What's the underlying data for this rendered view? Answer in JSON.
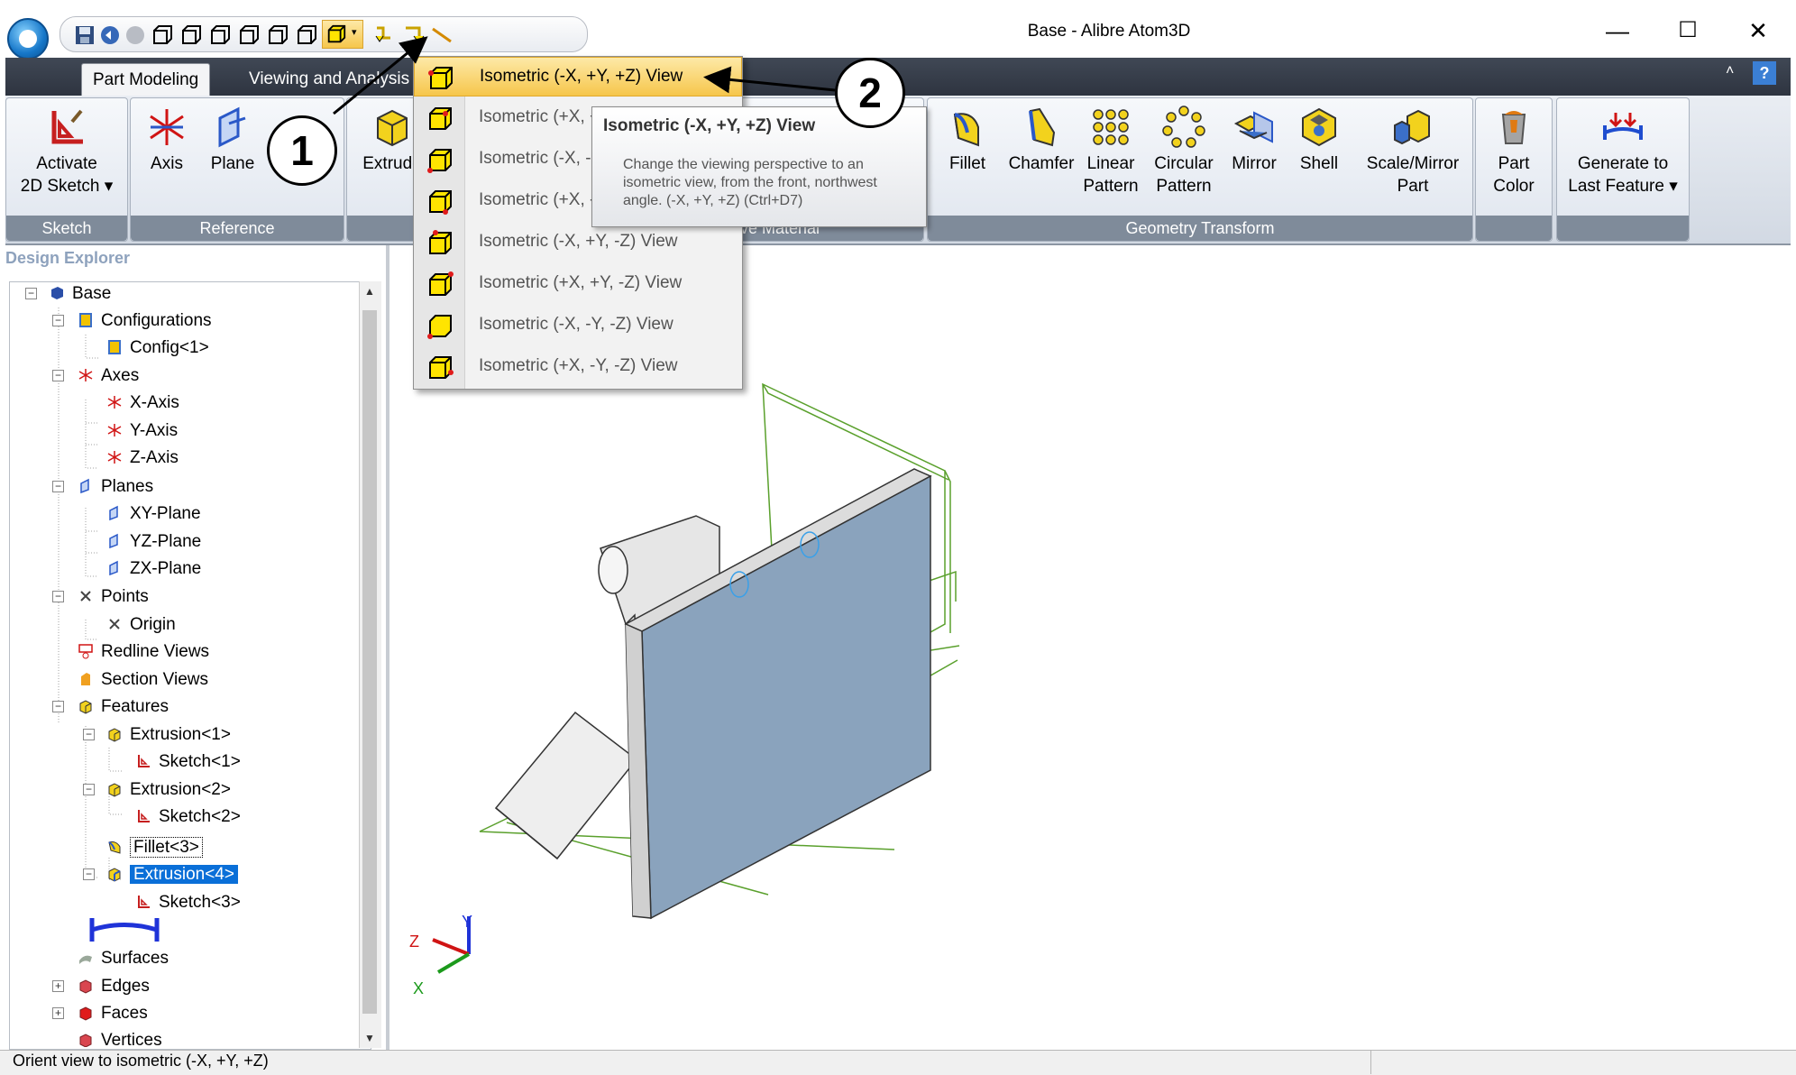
{
  "window": {
    "title": "Base - Alibre Atom3D",
    "minimize_glyph": "—",
    "maximize_glyph": "☐",
    "close_glyph": "✕"
  },
  "ribbon_tabs": [
    "Part Modeling",
    "Viewing and Analysis"
  ],
  "help_glyph": "?",
  "collapse_glyph": "˄",
  "ribbon_groups": {
    "sketch": {
      "label": "Sketch",
      "buttons": [
        {
          "label_line1": "Activate",
          "label_line2": "2D Sketch ▾"
        }
      ]
    },
    "reference": {
      "label": "Reference",
      "buttons": [
        {
          "label_line1": "Axis"
        },
        {
          "label_line1": "Plane"
        }
      ]
    },
    "add_material": {
      "buttons": [
        {
          "label_line1": "Extrude"
        }
      ]
    },
    "remove_material": {
      "label": "Remove Material"
    },
    "geometry_transform": {
      "label": "Geometry Transform",
      "buttons": [
        {
          "label_line1": "Fillet"
        },
        {
          "label_line1": "Chamfer"
        },
        {
          "label_line1": "Linear",
          "label_line2": "Pattern"
        },
        {
          "label_line1": "Circular",
          "label_line2": "Pattern"
        },
        {
          "label_line1": "Mirror"
        },
        {
          "label_line1": "Shell"
        },
        {
          "label_line1": "Scale/Mirror",
          "label_line2": "Part"
        }
      ]
    },
    "part_color": {
      "buttons": [
        {
          "label_line1": "Part",
          "label_line2": "Color"
        }
      ]
    },
    "generate": {
      "buttons": [
        {
          "label_line1": "Generate to",
          "label_line2": "Last Feature ▾"
        }
      ]
    }
  },
  "design_explorer": {
    "title": "Design Explorer",
    "scroll_up": "▲",
    "scroll_down": "▼",
    "tree": [
      {
        "label": "Base",
        "icon": "part-icon"
      },
      {
        "label": "Configurations",
        "icon": "configurations-icon"
      },
      {
        "label": "Config<1>",
        "icon": "config-icon"
      },
      {
        "label": "Axes",
        "icon": "axes-icon"
      },
      {
        "label": "X-Axis",
        "icon": "axis-icon"
      },
      {
        "label": "Y-Axis",
        "icon": "axis-icon"
      },
      {
        "label": "Z-Axis",
        "icon": "axis-icon"
      },
      {
        "label": "Planes",
        "icon": "planes-icon"
      },
      {
        "label": "XY-Plane",
        "icon": "plane-icon"
      },
      {
        "label": "YZ-Plane",
        "icon": "plane-icon"
      },
      {
        "label": "ZX-Plane",
        "icon": "plane-icon"
      },
      {
        "label": "Points",
        "icon": "points-icon"
      },
      {
        "label": "Origin",
        "icon": "point-icon"
      },
      {
        "label": "Redline Views",
        "icon": "redline-icon"
      },
      {
        "label": "Section Views",
        "icon": "section-icon"
      },
      {
        "label": "Features",
        "icon": "features-icon"
      },
      {
        "label": "Extrusion<1>",
        "icon": "extrusion-icon"
      },
      {
        "label": "Sketch<1>",
        "icon": "sketch-icon"
      },
      {
        "label": "Extrusion<2>",
        "icon": "extrusion-icon"
      },
      {
        "label": "Sketch<2>",
        "icon": "sketch-icon"
      },
      {
        "label": "Fillet<3>",
        "icon": "fillet-icon"
      },
      {
        "label": "Extrusion<4>",
        "icon": "extrusion-icon"
      },
      {
        "label": "Sketch<3>",
        "icon": "sketch-icon"
      },
      {
        "label": "",
        "icon": "rollback-bar-icon"
      },
      {
        "label": "Surfaces",
        "icon": "surfaces-icon"
      },
      {
        "label": "Edges",
        "icon": "edges-icon"
      },
      {
        "label": "Faces",
        "icon": "faces-icon"
      },
      {
        "label": "Vertices",
        "icon": "vertices-icon"
      }
    ],
    "selected_item": "Extrusion<4>",
    "focused_item": "Fillet<3>"
  },
  "view_menu": {
    "items": [
      "Isometric (-X, +Y, +Z) View",
      "Isometric (+X, +Y, +Z) View",
      "Isometric (-X, -Y, +Z) View",
      "Isometric (+X, -Y, +Z) View",
      "Isometric (-X, +Y, -Z) View",
      "Isometric (+X, +Y, -Z) View",
      "Isometric (-X, -Y, -Z) View",
      "Isometric (+X, -Y, -Z) View"
    ],
    "highlighted_index": 0
  },
  "tooltip": {
    "title": "Isometric (-X, +Y, +Z) View",
    "body": "Change the viewing perspective to an isometric view, from the front, northwest angle. (-X, +Y, +Z) (Ctrl+D7)"
  },
  "triad": {
    "x": "X",
    "y": "Y",
    "z": "Z"
  },
  "callouts": {
    "first": "1",
    "second": "2"
  },
  "status": {
    "text": "Orient view to isometric (-X, +Y, +Z)"
  },
  "colors": {
    "accent": "#0a6fd8",
    "menu_highlight": "#f6c64b",
    "sketch_green": "#5aa02c",
    "part_face": "#8aa3bd"
  }
}
